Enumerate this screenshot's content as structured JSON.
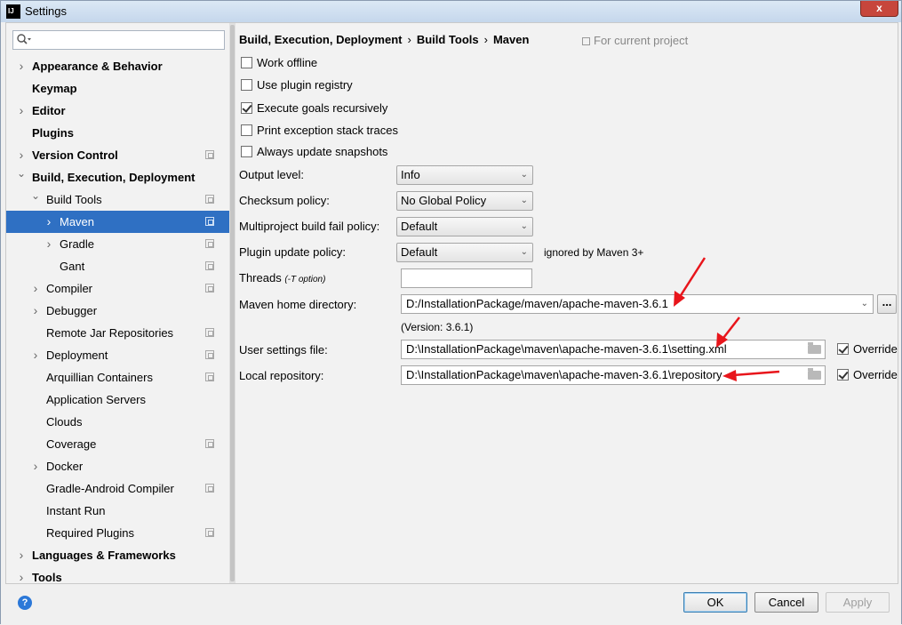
{
  "window": {
    "title": "Settings",
    "app_icon": "IJ",
    "close_symbol": "x"
  },
  "search": {
    "placeholder": "",
    "value": ""
  },
  "sidebar": {
    "items": [
      {
        "label": "Appearance & Behavior",
        "bold": true,
        "arrow": "collapsed",
        "level": 0,
        "project": false
      },
      {
        "label": "Keymap",
        "bold": true,
        "arrow": "none",
        "level": 0,
        "project": false
      },
      {
        "label": "Editor",
        "bold": true,
        "arrow": "collapsed",
        "level": 0,
        "project": false
      },
      {
        "label": "Plugins",
        "bold": true,
        "arrow": "none",
        "level": 0,
        "project": false
      },
      {
        "label": "Version Control",
        "bold": true,
        "arrow": "collapsed",
        "level": 0,
        "project": true
      },
      {
        "label": "Build, Execution, Deployment",
        "bold": true,
        "arrow": "expanded",
        "level": 0,
        "project": false
      },
      {
        "label": "Build Tools",
        "bold": false,
        "arrow": "expanded",
        "level": 1,
        "project": true
      },
      {
        "label": "Maven",
        "bold": false,
        "arrow": "collapsed",
        "level": 2,
        "project": true,
        "selected": true
      },
      {
        "label": "Gradle",
        "bold": false,
        "arrow": "collapsed",
        "level": 2,
        "project": true
      },
      {
        "label": "Gant",
        "bold": false,
        "arrow": "none",
        "level": 2,
        "project": true
      },
      {
        "label": "Compiler",
        "bold": false,
        "arrow": "collapsed",
        "level": 1,
        "project": true
      },
      {
        "label": "Debugger",
        "bold": false,
        "arrow": "collapsed",
        "level": 1,
        "project": false
      },
      {
        "label": "Remote Jar Repositories",
        "bold": false,
        "arrow": "none",
        "level": 1,
        "project": true
      },
      {
        "label": "Deployment",
        "bold": false,
        "arrow": "collapsed",
        "level": 1,
        "project": true
      },
      {
        "label": "Arquillian Containers",
        "bold": false,
        "arrow": "none",
        "level": 1,
        "project": true
      },
      {
        "label": "Application Servers",
        "bold": false,
        "arrow": "none",
        "level": 1,
        "project": false
      },
      {
        "label": "Clouds",
        "bold": false,
        "arrow": "none",
        "level": 1,
        "project": false
      },
      {
        "label": "Coverage",
        "bold": false,
        "arrow": "none",
        "level": 1,
        "project": true
      },
      {
        "label": "Docker",
        "bold": false,
        "arrow": "collapsed",
        "level": 1,
        "project": false
      },
      {
        "label": "Gradle-Android Compiler",
        "bold": false,
        "arrow": "none",
        "level": 1,
        "project": true
      },
      {
        "label": "Instant Run",
        "bold": false,
        "arrow": "none",
        "level": 1,
        "project": false
      },
      {
        "label": "Required Plugins",
        "bold": false,
        "arrow": "none",
        "level": 1,
        "project": true
      },
      {
        "label": "Languages & Frameworks",
        "bold": true,
        "arrow": "collapsed",
        "level": 0,
        "project": false
      },
      {
        "label": "Tools",
        "bold": true,
        "arrow": "collapsed",
        "level": 0,
        "project": false
      }
    ]
  },
  "breadcrumb": {
    "part1": "Build, Execution, Deployment",
    "part2": "Build Tools",
    "part3": "Maven",
    "separator": "›"
  },
  "for_project": "For current project",
  "checkboxes": [
    {
      "label": "Work offline",
      "checked": false
    },
    {
      "label": "Use plugin registry",
      "checked": false
    },
    {
      "label": "Execute goals recursively",
      "checked": true
    },
    {
      "label": "Print exception stack traces",
      "checked": false
    },
    {
      "label": "Always update snapshots",
      "checked": false
    }
  ],
  "form": {
    "output_level": {
      "label": "Output level:",
      "value": "Info"
    },
    "checksum_policy": {
      "label": "Checksum policy:",
      "value": "No Global Policy"
    },
    "multiproject_fail": {
      "label": "Multiproject build fail policy:",
      "value": "Default"
    },
    "plugin_update": {
      "label": "Plugin update policy:",
      "value": "Default",
      "note": "ignored by Maven 3+"
    },
    "threads": {
      "label": "Threads",
      "hint": "(-T option)",
      "value": ""
    },
    "maven_home": {
      "label": "Maven home directory:",
      "value": "D:/InstallationPackage/maven/apache-maven-3.6.1",
      "version": "(Version: 3.6.1)",
      "browse": "..."
    },
    "user_settings": {
      "label": "User settings file:",
      "value": "D:\\InstallationPackage\\maven\\apache-maven-3.6.1\\setting.xml",
      "override_label": "Override",
      "override": true
    },
    "local_repo": {
      "label": "Local repository:",
      "value": "D:\\InstallationPackage\\maven\\apache-maven-3.6.1\\repository",
      "override_label": "Override",
      "override": true
    }
  },
  "annotation_color": "#e8151b",
  "footer": {
    "help": "?",
    "ok": "OK",
    "cancel": "Cancel",
    "apply": "Apply"
  }
}
